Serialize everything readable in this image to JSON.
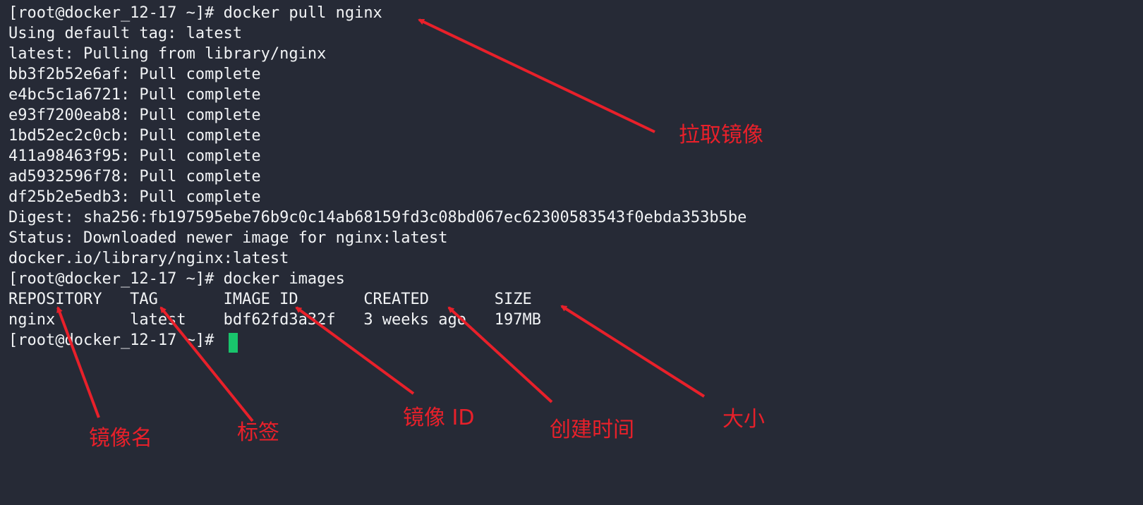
{
  "terminal": {
    "lines": [
      "[root@docker_12-17 ~]# docker pull nginx",
      "Using default tag: latest",
      "latest: Pulling from library/nginx",
      "bb3f2b52e6af: Pull complete",
      "e4bc5c1a6721: Pull complete",
      "e93f7200eab8: Pull complete",
      "1bd52ec2c0cb: Pull complete",
      "411a98463f95: Pull complete",
      "ad5932596f78: Pull complete",
      "df25b2e5edb3: Pull complete",
      "Digest: sha256:fb197595ebe76b9c0c14ab68159fd3c08bd067ec62300583543f0ebda353b5be",
      "Status: Downloaded newer image for nginx:latest",
      "docker.io/library/nginx:latest",
      "[root@docker_12-17 ~]# docker images",
      "REPOSITORY   TAG       IMAGE ID       CREATED       SIZE",
      "nginx        latest    bdf62fd3a32f   3 weeks ago   197MB",
      "[root@docker_12-17 ~]# "
    ]
  },
  "annotations": {
    "pull_image": "拉取镜像",
    "image_name": "镜像名",
    "tag": "标签",
    "image_id": "镜像 ID",
    "created_time": "创建时间",
    "size": "大小"
  },
  "colors": {
    "background": "#262a36",
    "text": "#f1f3f5",
    "cursor": "#19c46c",
    "annotation": "#e8202a"
  }
}
